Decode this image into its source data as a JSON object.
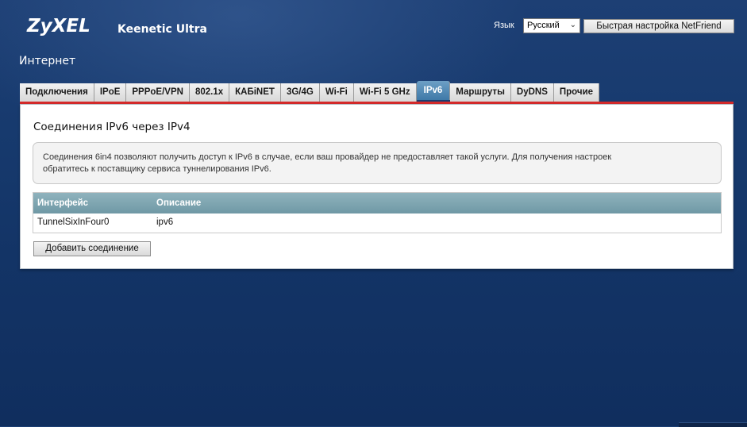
{
  "header": {
    "brand": "ZyXEL",
    "product": "Keenetic Ultra",
    "language_label": "Язык",
    "language_value": "Русский",
    "quick_setup_label": "Быстрая настройка NetFriend"
  },
  "page": {
    "title": "Интернет"
  },
  "tabs": [
    {
      "label": "Подключения"
    },
    {
      "label": "IPoE"
    },
    {
      "label": "PPPoE/VPN"
    },
    {
      "label": "802.1x"
    },
    {
      "label": "КАБiNET"
    },
    {
      "label": "3G/4G"
    },
    {
      "label": "Wi-Fi"
    },
    {
      "label": "Wi-Fi 5 GHz"
    },
    {
      "label": "IPv6"
    },
    {
      "label": "Маршруты"
    },
    {
      "label": "DyDNS"
    },
    {
      "label": "Прочие"
    }
  ],
  "active_tab": "IPv6",
  "panel": {
    "title": "Соединения IPv6 через IPv4",
    "info_line1": "Соединения 6in4 позволяют получить доступ к IPv6 в случае, если ваш провайдер не предоставляет такой услуги. Для получения настроек",
    "info_line2": "обратитесь к поставщику сервиса туннелирования IPv6.",
    "table": {
      "headers": [
        "Интерфейс",
        "Описание"
      ],
      "rows": [
        [
          "TunnelSixInFour0",
          "ipv6"
        ]
      ]
    },
    "add_button_label": "Добавить соединение"
  },
  "colors": {
    "background": "#173a6e",
    "active_tab": "#4f88b5",
    "accent_line": "#d42a2a",
    "table_header": "#7fa6b1"
  }
}
